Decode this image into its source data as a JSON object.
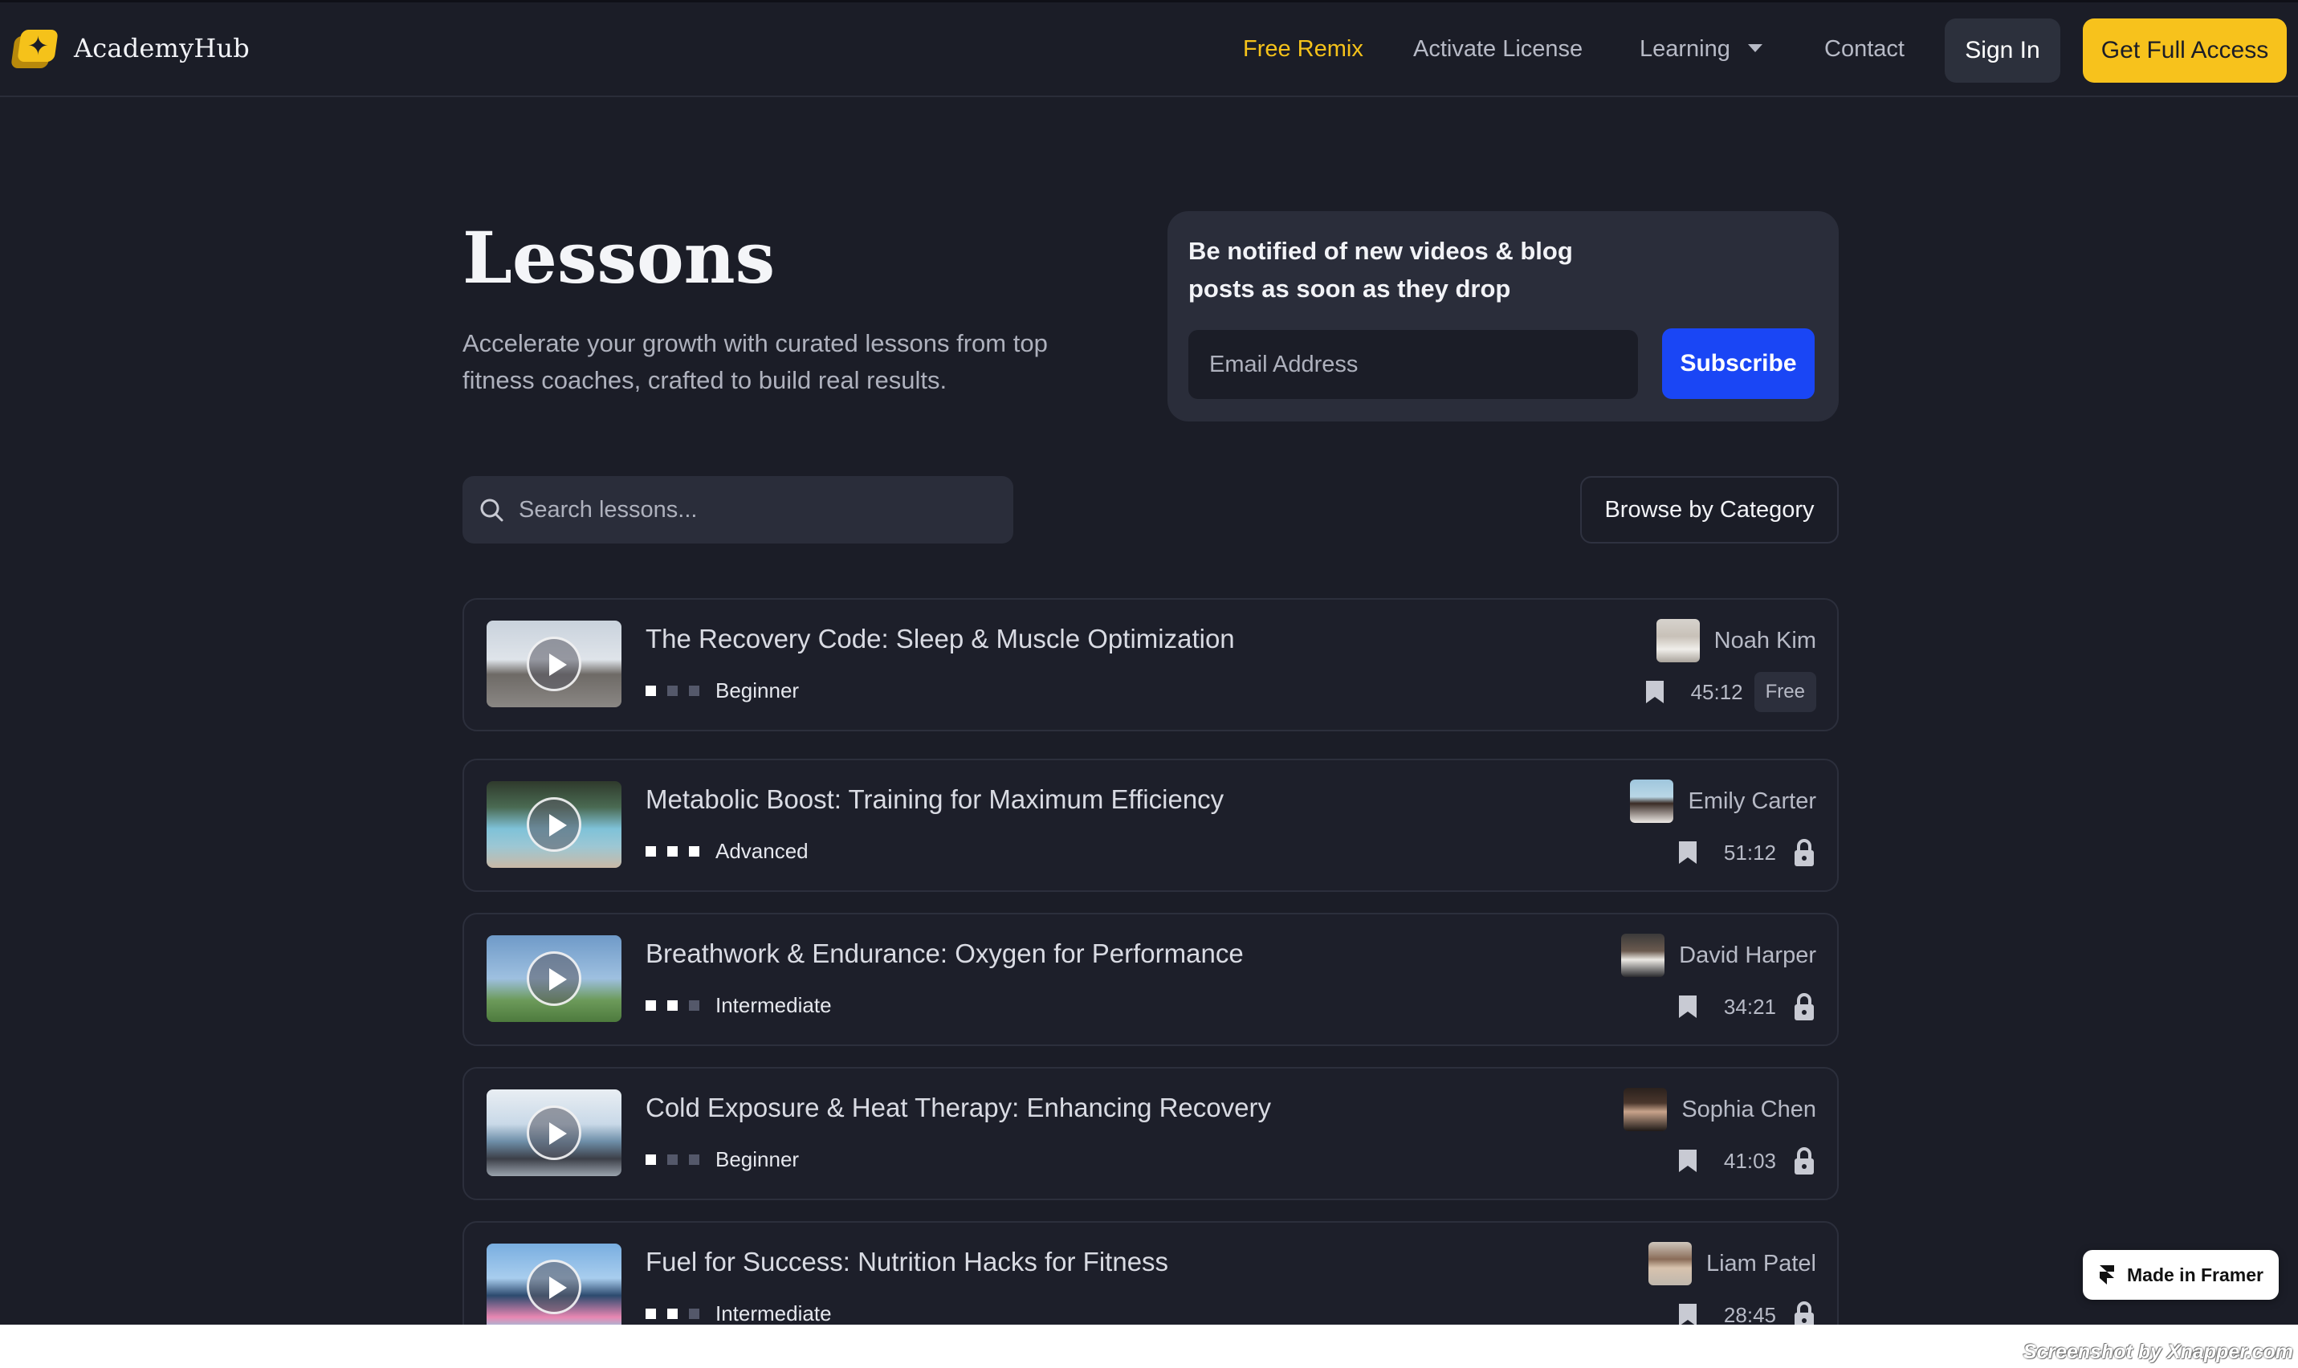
{
  "brand": {
    "name": "AcademyHub"
  },
  "nav": {
    "links": [
      {
        "label": "Free Remix"
      },
      {
        "label": "Activate License"
      },
      {
        "label": "Learning"
      },
      {
        "label": "Contact"
      }
    ],
    "sign_in": "Sign In",
    "full_access": "Get Full Access"
  },
  "hero": {
    "title": "Lessons",
    "description": "Accelerate your growth with curated lessons from top fitness coaches, crafted to build real results."
  },
  "notify": {
    "text": "Be notified of new videos & blog posts as soon as they drop",
    "email_placeholder": "Email Address",
    "subscribe": "Subscribe"
  },
  "search": {
    "placeholder": "Search lessons..."
  },
  "browse": {
    "label": "Browse by Category"
  },
  "lessons": [
    {
      "title": "The Recovery Code: Sleep & Muscle Optimization",
      "level": "Beginner",
      "level_value": 1,
      "author": "Noah Kim",
      "duration": "45:12",
      "badge": "Free",
      "locked": false
    },
    {
      "title": "Metabolic Boost: Training for Maximum Efficiency",
      "level": "Advanced",
      "level_value": 3,
      "author": "Emily Carter",
      "duration": "51:12",
      "badge": "",
      "locked": true
    },
    {
      "title": "Breathwork & Endurance: Oxygen for Performance",
      "level": "Intermediate",
      "level_value": 2,
      "author": "David Harper",
      "duration": "34:21",
      "badge": "",
      "locked": true
    },
    {
      "title": "Cold Exposure & Heat Therapy: Enhancing Recovery",
      "level": "Beginner",
      "level_value": 1,
      "author": "Sophia Chen",
      "duration": "41:03",
      "badge": "",
      "locked": true
    },
    {
      "title": "Fuel for Success: Nutrition Hacks for Fitness",
      "level": "Intermediate",
      "level_value": 2,
      "author": "Liam Patel",
      "duration": "28:45",
      "badge": "",
      "locked": true
    }
  ],
  "framer_badge": "Made in Framer",
  "watermark": "Screenshot by Xnapper.com",
  "colors": {
    "accent": "#f7c21c",
    "primary_button": "#1a46f5",
    "background": "#1b1d27",
    "card": "#2a2d3a"
  }
}
